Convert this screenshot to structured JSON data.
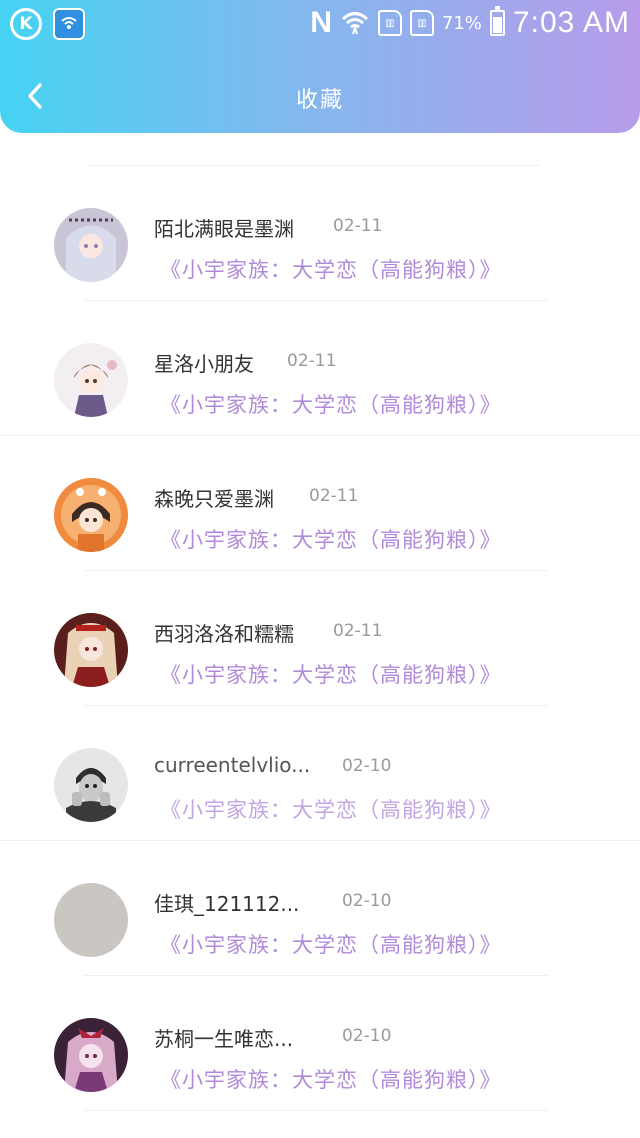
{
  "status_bar": {
    "k_icon": "K",
    "n_icon": "N",
    "battery_pct": "71%",
    "battery_level": 0.71,
    "time": "7:03 AM"
  },
  "header": {
    "title": "收藏",
    "back_icon": "chevron-left-icon"
  },
  "colors": {
    "gradient_start": "#45d3f3",
    "gradient_end": "#b79be9",
    "link_color": "#b08ad9"
  },
  "items": [
    {
      "username": "陌北满眼是墨渊",
      "date": "02-11",
      "title": "《小宇家族：大学恋（高能狗粮）》"
    },
    {
      "username": "星洛小朋友",
      "date": "02-11",
      "title": "《小宇家族：大学恋（高能狗粮）》"
    },
    {
      "username": "森晚只爱墨渊",
      "date": "02-11",
      "title": "《小宇家族：大学恋（高能狗粮）》"
    },
    {
      "username": "西羽洛洛和糯糯",
      "date": "02-11",
      "title": "《小宇家族：大学恋（高能狗粮）》"
    },
    {
      "username": "curreentelvlio...",
      "date": "02-10",
      "title": "《小宇家族：大学恋（高能狗粮）》"
    },
    {
      "username": "佳琪_121112...",
      "date": "02-10",
      "title": "《小宇家族：大学恋（高能狗粮）》"
    },
    {
      "username": "苏桐一生唯恋...",
      "date": "02-10",
      "title": "《小宇家族：大学恋（高能狗粮）》"
    }
  ]
}
